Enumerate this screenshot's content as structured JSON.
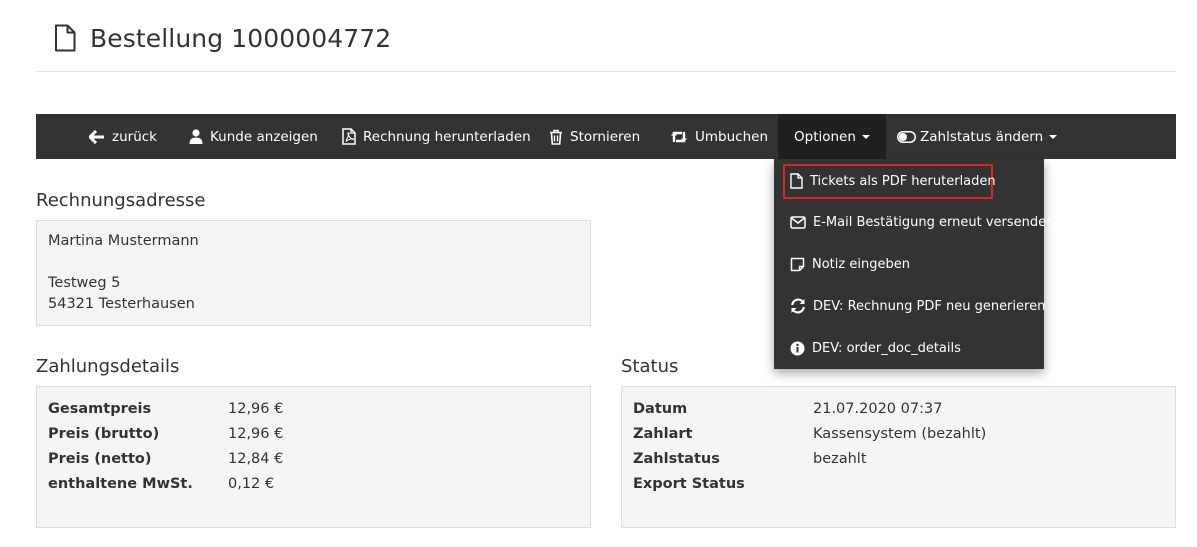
{
  "page": {
    "title": "Bestellung 1000004772"
  },
  "toolbar": {
    "back": "zurück",
    "show_customer": "Kunde anzeigen",
    "download_invoice": "Rechnung herunterladen",
    "cancel": "Stornieren",
    "rebook": "Umbuchen",
    "options": "Optionen",
    "payment_status": "Zahlstatus ändern"
  },
  "options_menu": {
    "items": [
      "Tickets als PDF heruterladen",
      "E-Mail Bestätigung erneut versenden",
      "Notiz eingeben",
      "DEV: Rechnung PDF neu generieren",
      "DEV: order_doc_details"
    ]
  },
  "billing_address": {
    "heading": "Rechnungsadresse",
    "name": "Martina Mustermann",
    "street": "Testweg 5",
    "city": "54321 Testerhausen"
  },
  "payment_details": {
    "heading": "Zahlungsdetails",
    "rows": [
      {
        "label": "Gesamtpreis",
        "value": "12,96 €"
      },
      {
        "label": "Preis (brutto)",
        "value": "12,96 €"
      },
      {
        "label": "Preis (netto)",
        "value": "12,84 €"
      },
      {
        "label": "enthaltene MwSt.",
        "value": "0,12 €"
      }
    ]
  },
  "status": {
    "heading": "Status",
    "rows": [
      {
        "label": "Datum",
        "value": "21.07.2020 07:37"
      },
      {
        "label": "Zahlart",
        "value": "Kassensystem (bezahlt)"
      },
      {
        "label": "Zahlstatus",
        "value": "bezahlt"
      },
      {
        "label": "Export Status",
        "value": ""
      }
    ]
  },
  "colors": {
    "navbar": "#333333",
    "active_tab": "#202020",
    "highlight_border": "#d9262c",
    "well_bg": "#f5f5f5"
  }
}
